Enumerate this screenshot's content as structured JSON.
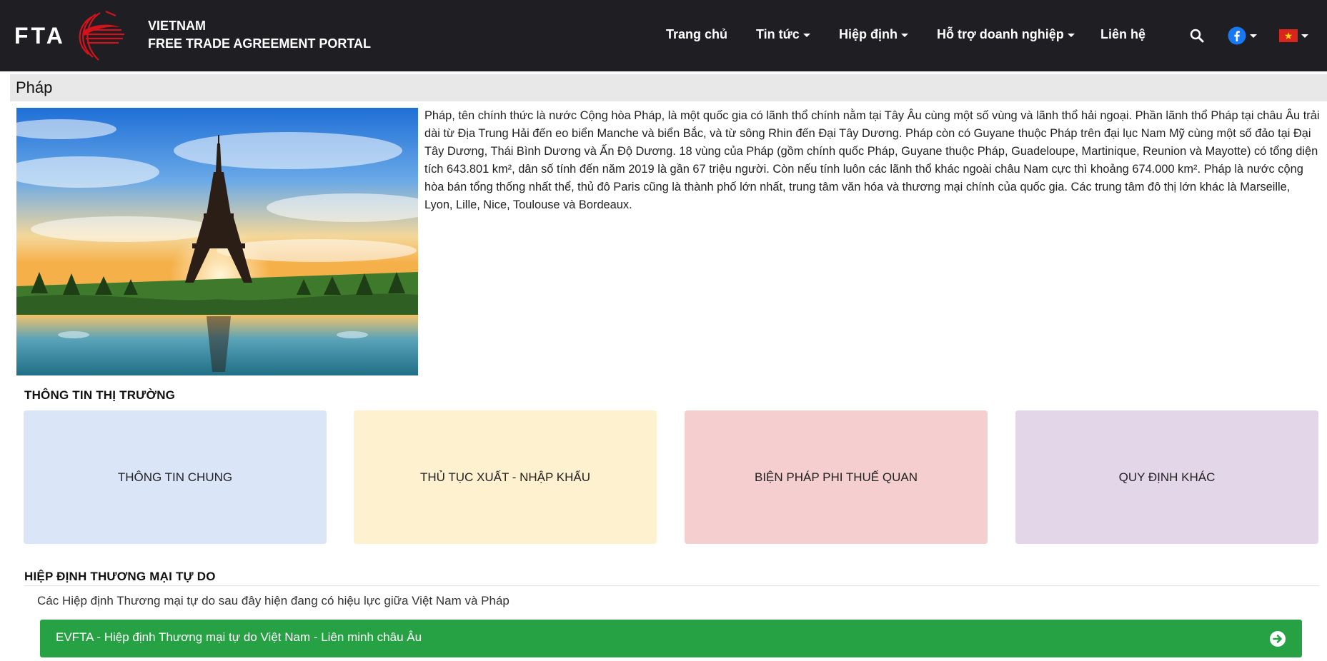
{
  "header": {
    "logo_text": "FTA",
    "portal_line1": "VIETNAM",
    "portal_line2": "FREE TRADE AGREEMENT PORTAL",
    "nav": [
      {
        "label": "Trang chủ",
        "dropdown": false
      },
      {
        "label": "Tin tức",
        "dropdown": true
      },
      {
        "label": "Hiệp định",
        "dropdown": true
      },
      {
        "label": "Hỗ trợ doanh nghiệp",
        "dropdown": true
      },
      {
        "label": "Liên hệ",
        "dropdown": false
      }
    ],
    "icons": {
      "search": "search-icon",
      "facebook": "facebook-icon",
      "language": "vietnam-flag-icon"
    }
  },
  "page": {
    "title": "Pháp",
    "hero_alt": "Eiffel tower",
    "intro": "Pháp, tên chính thức là nước Cộng hòa Pháp, là một quốc gia có lãnh thổ chính nằm tại Tây Âu cùng một số vùng và lãnh thổ hải ngoại. Phần lãnh thổ Pháp tại châu Âu trải dài từ Địa Trung Hải đến eo biển Manche và biển Bắc, và từ sông Rhin đến Đại Tây Dương. Pháp còn có Guyane thuộc Pháp trên đại lục Nam Mỹ cùng một số đảo tại Đại Tây Dương, Thái Bình Dương và Ấn Độ Dương. 18 vùng của Pháp (gồm chính quốc Pháp, Guyane thuộc Pháp, Guadeloupe, Martinique, Reunion và Mayotte) có tổng diện tích 643.801 km², dân số tính đến năm 2019 là gần 67 triệu người. Còn nếu tính luôn các lãnh thổ khác ngoài châu Nam cực thì khoảng 674.000  km². Pháp là nước cộng hòa bán tổng thống nhất thể, thủ đô Paris cũng là thành phố lớn nhất, trung tâm văn hóa và thương mại chính của quốc gia. Các trung tâm đô thị lớn khác là Marseille, Lyon, Lille, Nice, Toulouse và Bordeaux."
  },
  "market": {
    "heading": "THÔNG TIN THỊ TRƯỜNG",
    "cards": [
      {
        "label": "THÔNG TIN CHUNG",
        "color": "#dae6f8"
      },
      {
        "label": "THỦ TỤC XUẤT - NHẬP KHẨU",
        "color": "#fdf1d0"
      },
      {
        "label": "BIỆN PHÁP PHI THUẾ QUAN",
        "color": "#f5cfcf"
      },
      {
        "label": "QUY ĐỊNH KHÁC",
        "color": "#e2d6e8"
      }
    ]
  },
  "fta": {
    "heading": "HIỆP ĐỊNH THƯƠNG MẠI TỰ DO",
    "note": "Các Hiệp định Thương mại tự do sau đây hiện đang có hiệu lực giữa Việt Nam và Pháp",
    "items": [
      {
        "label": "EVFTA - Hiệp định Thương mại tự do Việt Nam - Liên minh châu Âu",
        "color": "#26a143"
      }
    ]
  }
}
